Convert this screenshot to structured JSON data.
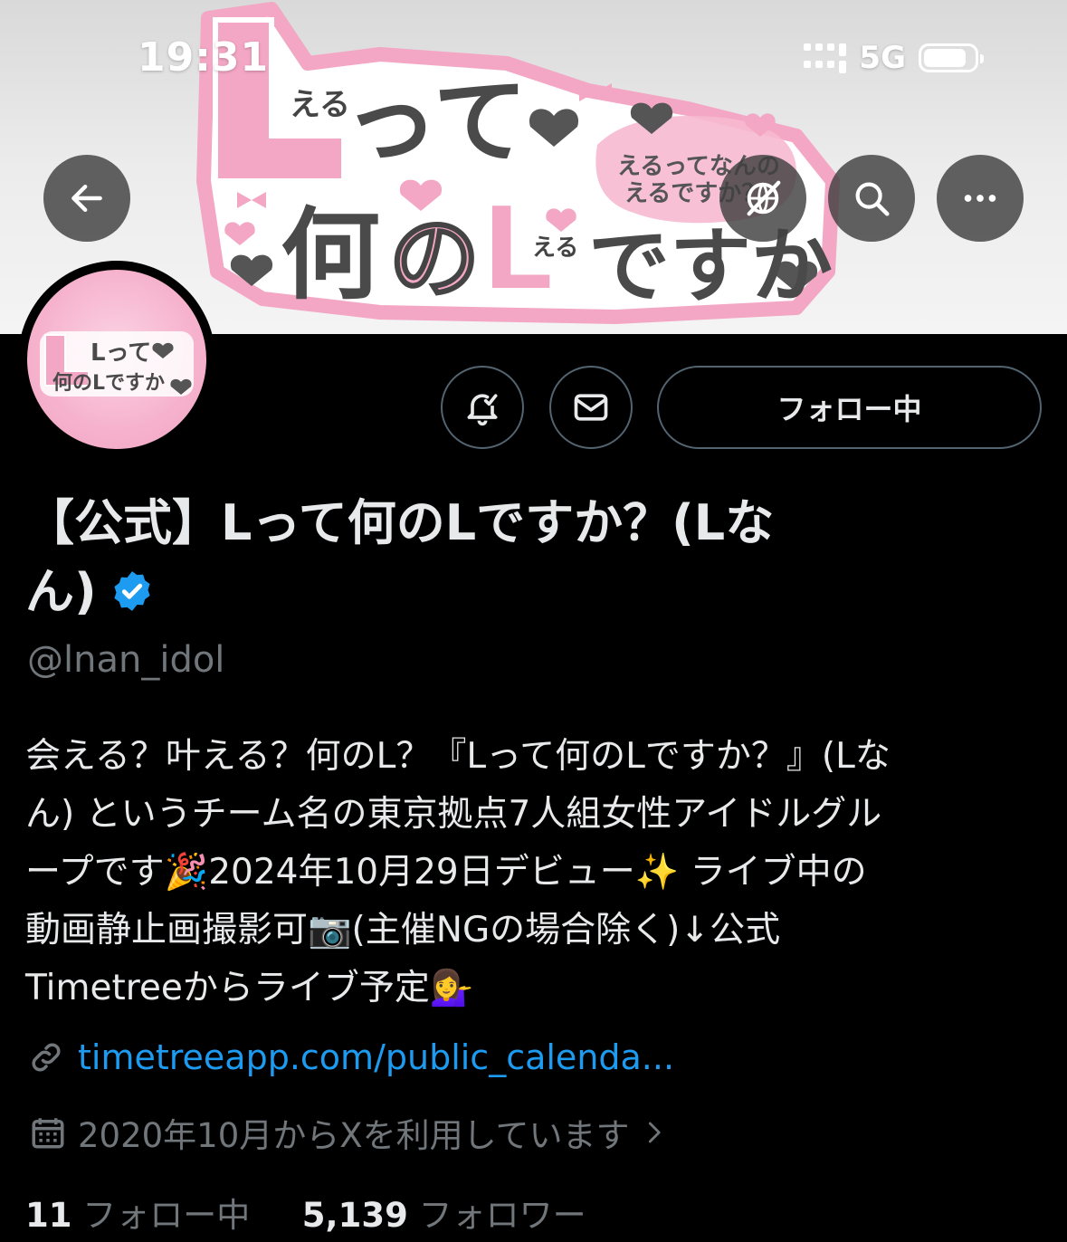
{
  "status_bar": {
    "time": "19:31",
    "network": "5G"
  },
  "banner": {
    "big_l": "L",
    "small_eru": "える",
    "tte": "って",
    "nan": "何",
    "no": "の",
    "desuka": "ですか",
    "bubble_line1": "えるってなんの",
    "bubble_line2": "えるですか？"
  },
  "avatar": {
    "line1": "Lって",
    "line2": "何のLですか"
  },
  "actions": {
    "follow_label": "フォロー中"
  },
  "profile": {
    "name_line1": "【公式】Lって何のLですか？(Lな",
    "name_line2": "ん)",
    "handle": "@lnan_idol",
    "bio_lines": [
      "会える？叶える？何のL？『Lって何のLですか？』(Lな",
      "ん) というチーム名の東京拠点7人組女性アイドルグル",
      "ープです🎉2024年10月29日デビュー✨ ライブ中の",
      "動画静止画撮影可📷(主催NGの場合除く)↓公式",
      "Timetreeからライブ予定💁‍♀️"
    ],
    "link": "timetreeapp.com/public_calenda...",
    "joined": "2020年10月からXを利用しています",
    "following_count": "11",
    "following_label": "フォロー中",
    "followers_count": "5,139",
    "followers_label": "フォロワー"
  },
  "icons": {
    "back": "arrow-left-icon",
    "translate": "globe-off-icon",
    "search": "search-icon",
    "more": "more-horizontal-icon",
    "notify": "bell-check-icon",
    "message": "envelope-icon",
    "link": "link-icon",
    "calendar": "calendar-icon",
    "verified": "verified-badge-icon"
  },
  "colors": {
    "accent": "#1d9bf0",
    "muted": "#71767b",
    "pink": "#f3a7c4",
    "text": "#e7e9ea"
  }
}
